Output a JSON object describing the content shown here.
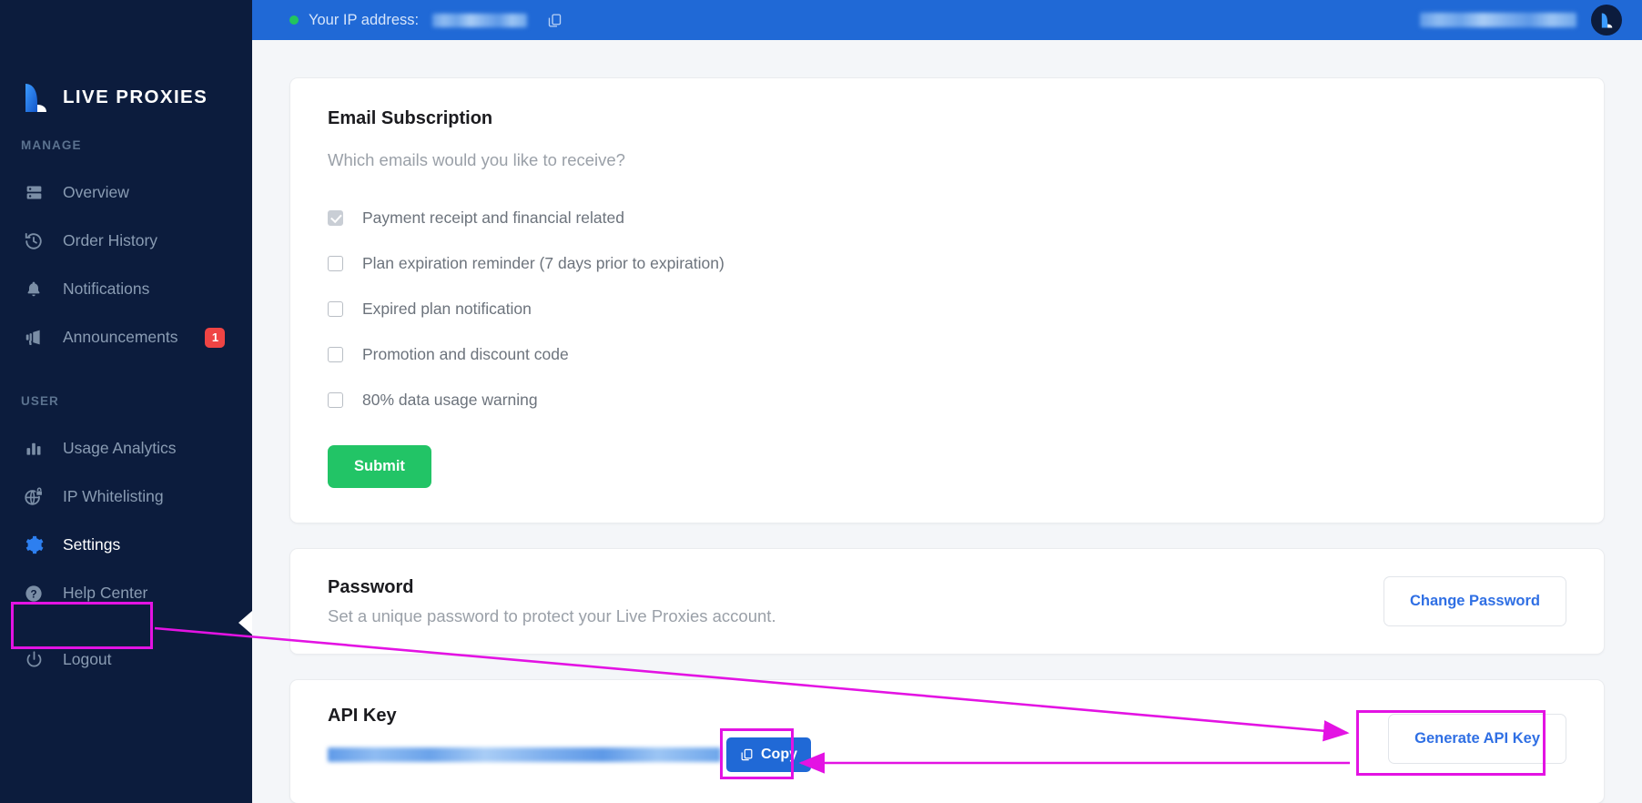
{
  "brand": {
    "name": "LIVE PROXIES",
    "logo_icon": "live-proxies-logo",
    "accent_blue": "#2069d6",
    "sidebar_bg": "#0c1c3d",
    "annotation_color": "#e313e3",
    "success_green": "#22c466"
  },
  "topbar": {
    "ip_label": "Your IP address:",
    "ip_value": "",
    "status_dot": "online-dot",
    "copy_icon": "copy-icon",
    "user_name": "",
    "avatar_icon": "user-avatar"
  },
  "sidebar": {
    "sections": [
      {
        "title": "MANAGE",
        "items": [
          {
            "label": "Overview",
            "icon": "server-icon",
            "active": false,
            "badge": ""
          },
          {
            "label": "Order History",
            "icon": "history-clock-icon",
            "active": false,
            "badge": ""
          },
          {
            "label": "Notifications",
            "icon": "bell-icon",
            "active": false,
            "badge": ""
          },
          {
            "label": "Announcements",
            "icon": "megaphone-icon",
            "active": false,
            "badge": "1"
          }
        ]
      },
      {
        "title": "USER",
        "items": [
          {
            "label": "Usage Analytics",
            "icon": "bar-chart-icon",
            "active": false,
            "badge": ""
          },
          {
            "label": "IP Whitelisting",
            "icon": "globe-lock-icon",
            "active": false,
            "badge": ""
          },
          {
            "label": "Settings",
            "icon": "gear-icon",
            "active": true,
            "badge": ""
          },
          {
            "label": "Help Center",
            "icon": "question-mark-icon",
            "active": false,
            "badge": ""
          }
        ]
      }
    ],
    "logout": {
      "label": "Logout",
      "icon": "power-icon"
    }
  },
  "email_subscription": {
    "title": "Email Subscription",
    "subtitle": "Which emails would you like to receive?",
    "options": [
      {
        "label": "Payment receipt and financial related",
        "checked": true,
        "disabled": true
      },
      {
        "label": "Plan expiration reminder (7 days prior to expiration)",
        "checked": false,
        "disabled": false
      },
      {
        "label": "Expired plan notification",
        "checked": false,
        "disabled": false
      },
      {
        "label": "Promotion and discount code",
        "checked": false,
        "disabled": false
      },
      {
        "label": "80% data usage warning",
        "checked": false,
        "disabled": false
      }
    ],
    "submit_label": "Submit"
  },
  "password": {
    "title": "Password",
    "description": "Set a unique password to protect your Live Proxies account.",
    "button_label": "Change Password"
  },
  "api_key": {
    "title": "API Key",
    "value": "",
    "copy_label": "Copy",
    "copy_icon": "copy-icon",
    "generate_label": "Generate API Key"
  }
}
